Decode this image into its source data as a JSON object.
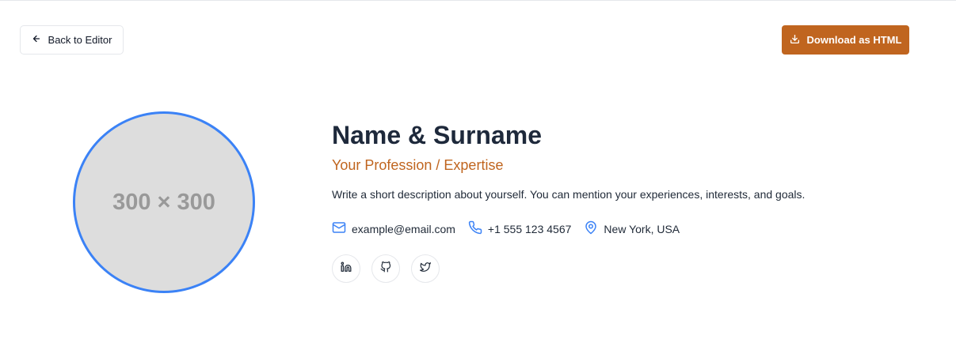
{
  "toolbar": {
    "back_label": "Back to Editor",
    "download_label": "Download as HTML"
  },
  "profile": {
    "avatar_placeholder": "300 × 300",
    "name": "Name & Surname",
    "profession": "Your Profession / Expertise",
    "description": "Write a short description about yourself. You can mention your experiences, interests, and goals.",
    "email": "example@email.com",
    "phone": "+1 555 123 4567",
    "location": "New York, USA"
  },
  "socials": [
    {
      "icon": "linkedin-icon"
    },
    {
      "icon": "github-icon"
    },
    {
      "icon": "twitter-icon"
    }
  ],
  "colors": {
    "accent": "#c0651f",
    "avatar_border": "#3b82f6",
    "icon_blue": "#3b82f6",
    "heading": "#1e293b"
  }
}
